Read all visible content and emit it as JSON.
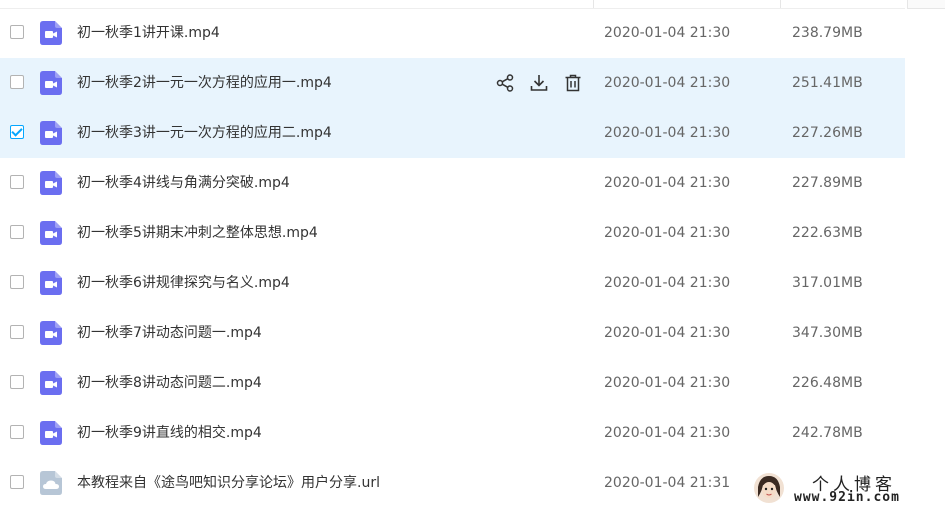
{
  "colors": {
    "video_icon": "#6b6ef0",
    "url_icon": "#b7c6d6",
    "highlight": "#e8f4fd",
    "accent": "#06a7ff"
  },
  "row_actions": [
    {
      "icon": "share-icon"
    },
    {
      "icon": "download-icon"
    },
    {
      "icon": "delete-icon"
    }
  ],
  "files": [
    {
      "name": "初一秋季1讲开课.mp4",
      "date": "2020-01-04 21:30",
      "size": "238.79MB",
      "type": "video",
      "checked": false,
      "highlighted": false
    },
    {
      "name": "初一秋季2讲一元一次方程的应用一.mp4",
      "date": "2020-01-04 21:30",
      "size": "251.41MB",
      "type": "video",
      "checked": false,
      "highlighted": true,
      "hovered": true
    },
    {
      "name": "初一秋季3讲一元一次方程的应用二.mp4",
      "date": "2020-01-04 21:30",
      "size": "227.26MB",
      "type": "video",
      "checked": true,
      "highlighted": true
    },
    {
      "name": "初一秋季4讲线与角满分突破.mp4",
      "date": "2020-01-04 21:30",
      "size": "227.89MB",
      "type": "video",
      "checked": false,
      "highlighted": false
    },
    {
      "name": "初一秋季5讲期末冲刺之整体思想.mp4",
      "date": "2020-01-04 21:30",
      "size": "222.63MB",
      "type": "video",
      "checked": false,
      "highlighted": false
    },
    {
      "name": "初一秋季6讲规律探究与名义.mp4",
      "date": "2020-01-04 21:30",
      "size": "317.01MB",
      "type": "video",
      "checked": false,
      "highlighted": false
    },
    {
      "name": "初一秋季7讲动态问题一.mp4",
      "date": "2020-01-04 21:30",
      "size": "347.30MB",
      "type": "video",
      "checked": false,
      "highlighted": false
    },
    {
      "name": "初一秋季8讲动态问题二.mp4",
      "date": "2020-01-04 21:30",
      "size": "226.48MB",
      "type": "video",
      "checked": false,
      "highlighted": false
    },
    {
      "name": "初一秋季9讲直线的相交.mp4",
      "date": "2020-01-04 21:30",
      "size": "242.78MB",
      "type": "video",
      "checked": false,
      "highlighted": false
    },
    {
      "name": "本教程来自《途鸟吧知识分享论坛》用户分享.url",
      "date": "2020-01-04 21:31",
      "size": "",
      "type": "url",
      "checked": false,
      "highlighted": false
    }
  ],
  "watermark": {
    "title": "个人博客",
    "url": "www.92in.com"
  }
}
